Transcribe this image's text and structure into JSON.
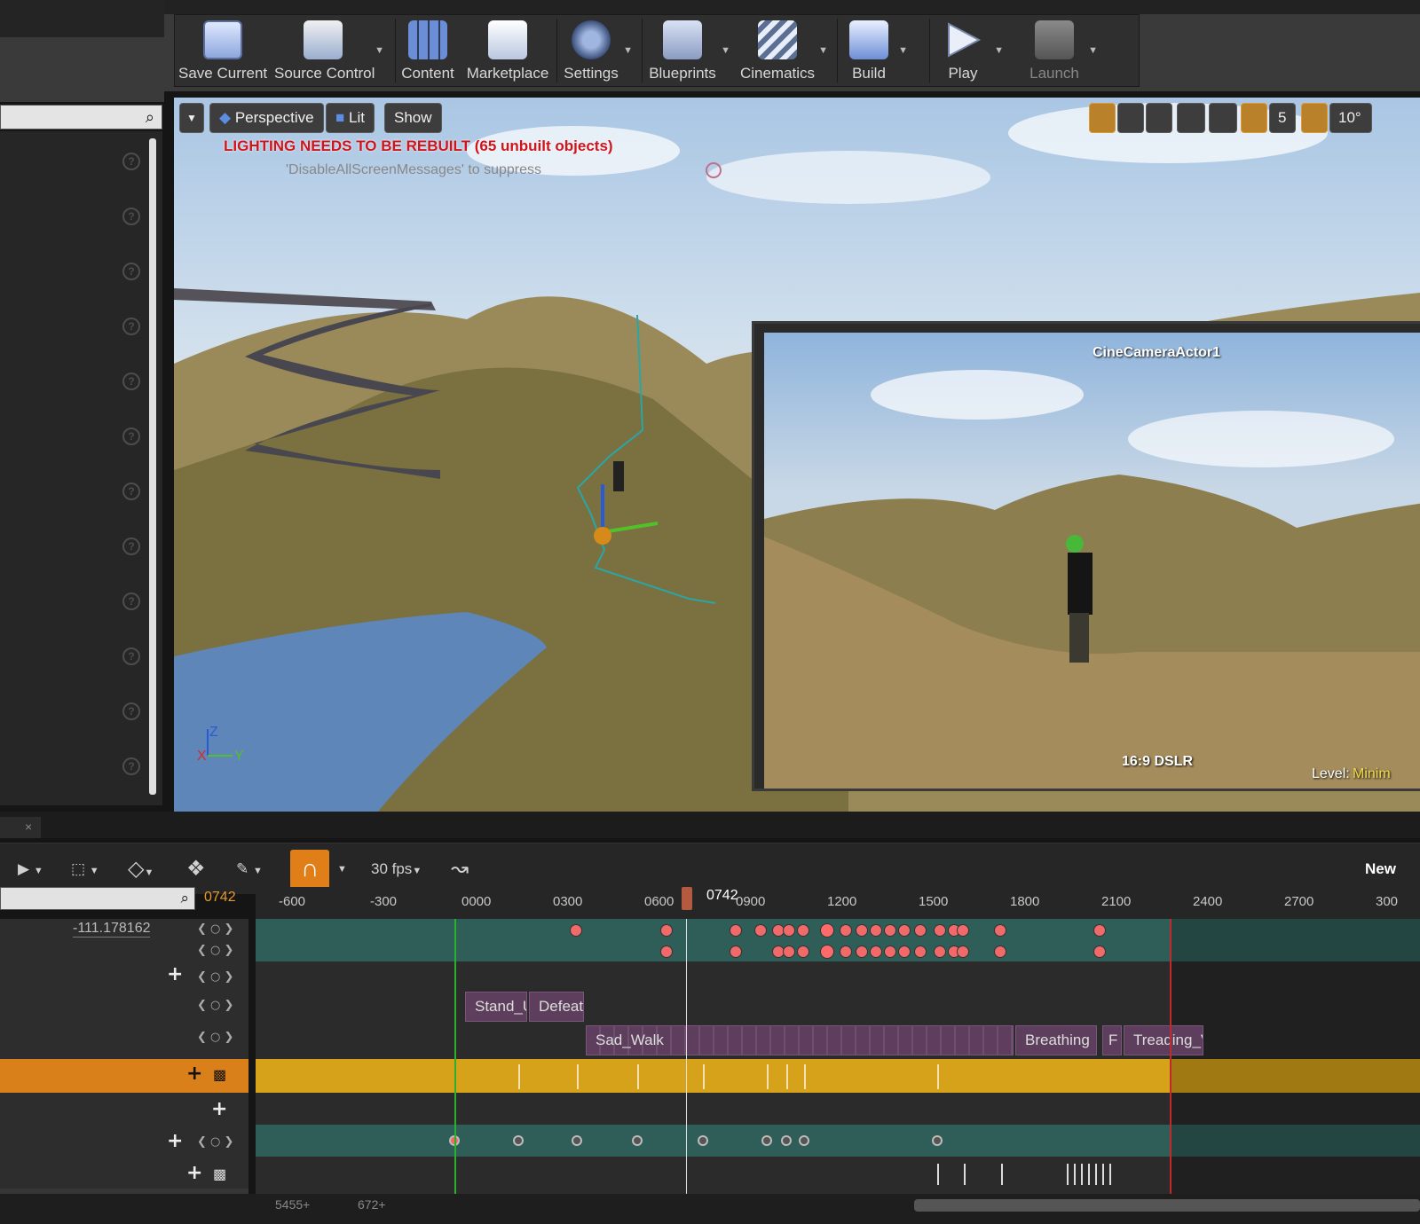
{
  "toolbar": {
    "buttons": [
      {
        "label": "Save Current",
        "icon": "floppy-disk-icon",
        "dropdown": false
      },
      {
        "label": "Source Control",
        "icon": "source-control-icon",
        "dropdown": true
      },
      {
        "label": "Content",
        "icon": "content-grid-icon",
        "dropdown": false
      },
      {
        "label": "Marketplace",
        "icon": "marketplace-bag-icon",
        "dropdown": false
      },
      {
        "label": "Settings",
        "icon": "settings-gear-icon",
        "dropdown": true
      },
      {
        "label": "Blueprints",
        "icon": "blueprint-gamepad-icon",
        "dropdown": true
      },
      {
        "label": "Cinematics",
        "icon": "clapperboard-icon",
        "dropdown": true
      },
      {
        "label": "Build",
        "icon": "build-cubes-icon",
        "dropdown": true
      },
      {
        "label": "Play",
        "icon": "play-triangle-icon",
        "dropdown": true
      },
      {
        "label": "Launch",
        "icon": "launch-icon",
        "dropdown": true
      }
    ]
  },
  "viewport": {
    "perspective": "Perspective",
    "lit": "Lit",
    "show": "Show",
    "grid_snap": "5",
    "rotation_snap": "10°",
    "warning": "LIGHTING NEEDS TO BE REBUILT (65 unbuilt objects)",
    "suppress_hint": "'DisableAllScreenMessages' to suppress",
    "axis_z": "Z",
    "axis_x": "X",
    "axis_y": "Y",
    "pip_title": "CineCameraActor1",
    "pip_format": "16:9 DSLR",
    "level_label": "Level:",
    "level_value": "Minim"
  },
  "sequencer": {
    "fps": "30 fps",
    "name_partial": "New",
    "current_frame": "0742",
    "playhead_label": "0742",
    "property_value": "-111.178162",
    "ruler_ticks": [
      "-600",
      "-300",
      "0000",
      "0300",
      "0600",
      "0900",
      "1200",
      "1500",
      "1800",
      "2100",
      "2400",
      "2700",
      "300"
    ],
    "anim_clips": [
      "Stand_U",
      "Defeat",
      "Sad_Walk",
      "Breathing",
      "F",
      "Treading_V"
    ],
    "bottom_values": [
      "5455+",
      "672+"
    ]
  }
}
